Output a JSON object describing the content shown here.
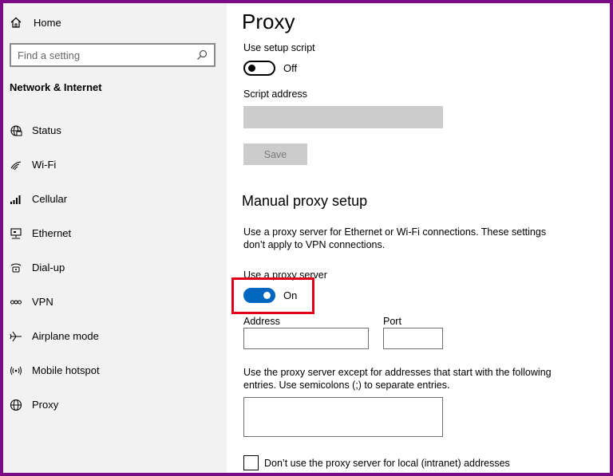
{
  "sidebar": {
    "home_label": "Home",
    "search_placeholder": "Find a setting",
    "section_title": "Network & Internet",
    "items": [
      {
        "label": "Status",
        "icon": "status-globe-icon"
      },
      {
        "label": "Wi-Fi",
        "icon": "wifi-icon"
      },
      {
        "label": "Cellular",
        "icon": "cellular-icon"
      },
      {
        "label": "Ethernet",
        "icon": "ethernet-icon"
      },
      {
        "label": "Dial-up",
        "icon": "dialup-icon"
      },
      {
        "label": "VPN",
        "icon": "vpn-icon"
      },
      {
        "label": "Airplane mode",
        "icon": "airplane-icon"
      },
      {
        "label": "Mobile hotspot",
        "icon": "hotspot-icon"
      },
      {
        "label": "Proxy",
        "icon": "globe-icon"
      }
    ]
  },
  "main": {
    "title": "Proxy",
    "setup_script": {
      "label": "Use setup script",
      "state": "Off",
      "enabled": false
    },
    "script_address": {
      "label": "Script address",
      "value": ""
    },
    "save_label": "Save",
    "manual": {
      "title": "Manual proxy setup",
      "description": "Use a proxy server for Ethernet or Wi-Fi connections. These settings don’t apply to VPN connections.",
      "use_proxy_label": "Use a proxy server",
      "use_proxy_state": "On",
      "use_proxy_enabled": true,
      "address_label": "Address",
      "address_value": "",
      "port_label": "Port",
      "port_value": "",
      "exceptions_description": "Use the proxy server except for addresses that start with the following entries. Use semicolons (;) to separate entries.",
      "exceptions_value": "",
      "local_bypass_label": "Don’t use the proxy server for local (intranet) addresses",
      "local_bypass_checked": false
    }
  },
  "colors": {
    "frame": "#7b0a86",
    "accent": "#0067c0",
    "highlight": "#e0001a",
    "sidebar_bg": "#f2f2f2"
  }
}
